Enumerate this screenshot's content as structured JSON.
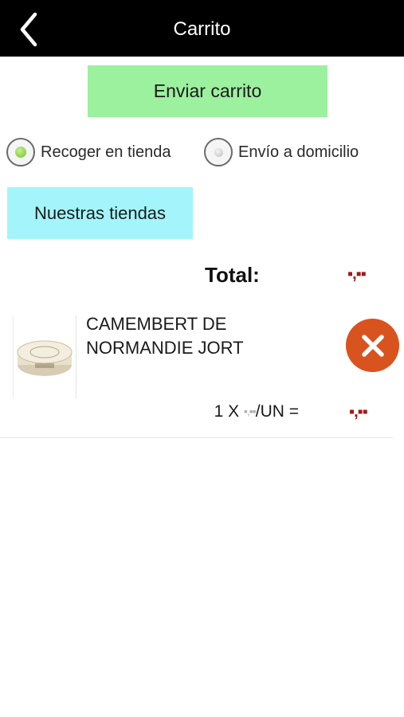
{
  "header": {
    "title": "Carrito",
    "back_icon": "chevron-left-icon"
  },
  "actions": {
    "send_label": "Enviar carrito",
    "stores_label": "Nuestras tiendas"
  },
  "delivery": {
    "options": [
      {
        "label": "Recoger en tienda",
        "selected": true
      },
      {
        "label": "Envío a domicilio",
        "selected": false
      }
    ]
  },
  "cart": {
    "total_label": "Total:",
    "total_value": "▪,▪▪",
    "items": [
      {
        "name": "CAMEMBERT DE NORMANDIE JORT",
        "quantity": "1 X",
        "unit_price": "▪,▪▪",
        "unit": "/UN =",
        "line_total": "▪,▪▪",
        "remove_icon": "close-icon"
      }
    ]
  },
  "colors": {
    "header_bg": "#000000",
    "send_button_bg": "#9cf19e",
    "stores_button_bg": "#a3f5fb",
    "price_color": "#a01818",
    "remove_button_bg": "#d9531e"
  }
}
